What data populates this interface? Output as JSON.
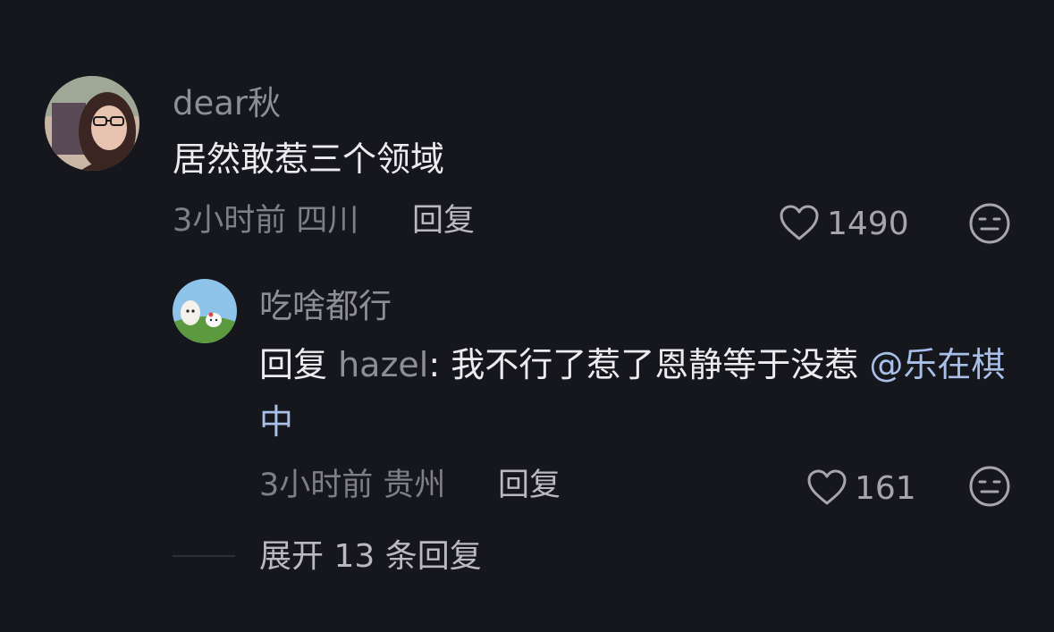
{
  "colors": {
    "background": "#16161d",
    "primary_text": "#ececf0",
    "secondary_text": "#8e8e95",
    "mention_link": "#a8bfe8"
  },
  "comment": {
    "username": "dear秋",
    "text": "居然敢惹三个领域",
    "time_location": "3小时前 四川",
    "reply_label": "回复",
    "likes": "1490"
  },
  "reply": {
    "username": "吃啥都行",
    "prefix": "回复 ",
    "reply_to": "hazel",
    "separator": ": ",
    "text": "我不行了惹了恩静等于没惹 ",
    "mention": "@乐在棋中",
    "time_location": "3小时前 贵州",
    "reply_label": "回复",
    "likes": "161"
  },
  "expand": {
    "label": "展开 13 条回复"
  },
  "icons": {
    "like": "heart-outline-icon",
    "dislike": "neutral-face-icon"
  }
}
